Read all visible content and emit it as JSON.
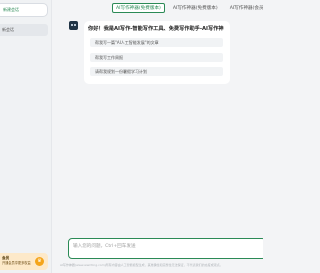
{
  "sidebar": {
    "new_chat": "新建会话",
    "history_item": "新会话",
    "promo_title": "会员",
    "promo_subtitle": "开通会员享更多权益",
    "promo_icon": "crown-icon"
  },
  "tabs": [
    {
      "label": "AI写作神器(免费版本)",
      "active": true
    },
    {
      "label": "AI写作神器(免费版本)",
      "active": false
    },
    {
      "label": "AI写作神器(会员版本)",
      "active": false
    }
  ],
  "chat": {
    "greeting": "你好！我是AI写作-智能写作工具、免费写作助手-AI写作神",
    "suggestions": [
      "帮我写一篇\"AI人工智能发展\"的文章",
      "帮我写工作周报",
      "请帮我规划一份暑假学习计划"
    ]
  },
  "input": {
    "placeholder": "输入您的问题，Ctrl+回车发送"
  },
  "footer": {
    "text": "AI写作神器(www.aiwriting.com)所有内容由人工智能模型生成，其准确性和完整性无法保证，不代表我们的态度或观点。"
  },
  "colors": {
    "accent": "#2b8a56",
    "sidebar_bg": "#f0f2f4",
    "main_bg": "#f3f4f6",
    "promo_bg": "#fde9c9"
  }
}
